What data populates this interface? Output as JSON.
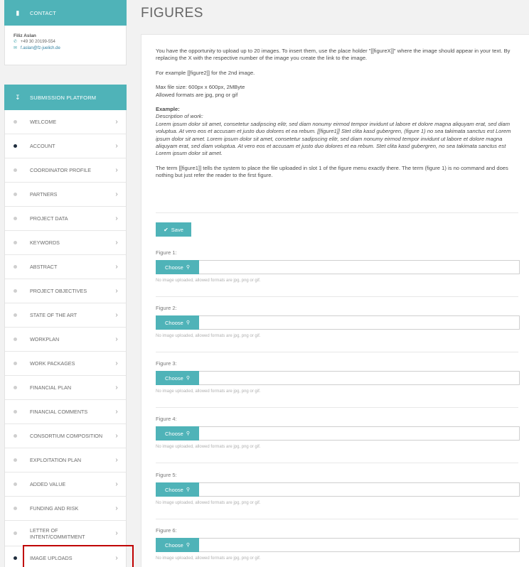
{
  "contact": {
    "header": "CONTACT",
    "name": "Filiz Aslan",
    "phone": "+49 30 20199-554",
    "email": "f.aslan@fz-juelich.de"
  },
  "submission": {
    "header": "SUBMISSION PLATFORM",
    "items": [
      {
        "label": "WELCOME",
        "status": "empty"
      },
      {
        "label": "ACCOUNT",
        "status": "done"
      },
      {
        "label": "COORDINATOR PROFILE",
        "status": "empty"
      },
      {
        "label": "PARTNERS",
        "status": "empty"
      },
      {
        "label": "PROJECT DATA",
        "status": "empty"
      },
      {
        "label": "KEYWORDS",
        "status": "empty"
      },
      {
        "label": "ABSTRACT",
        "status": "empty"
      },
      {
        "label": "PROJECT OBJECTIVES",
        "status": "empty"
      },
      {
        "label": "STATE OF THE ART",
        "status": "empty"
      },
      {
        "label": "WORKPLAN",
        "status": "empty"
      },
      {
        "label": "WORK PACKAGES",
        "status": "empty"
      },
      {
        "label": "FINANCIAL PLAN",
        "status": "empty"
      },
      {
        "label": "FINANCIAL COMMENTS",
        "status": "empty"
      },
      {
        "label": "CONSORTIUM COMPOSITION",
        "status": "empty"
      },
      {
        "label": "EXPLOITATION PLAN",
        "status": "empty"
      },
      {
        "label": "ADDED VALUE",
        "status": "empty"
      },
      {
        "label": "FUNDING AND RISK",
        "status": "empty"
      },
      {
        "label": "LETTER OF INTENT/COMMITMENT",
        "status": "empty"
      },
      {
        "label": "IMAGE UPLOADS",
        "status": "done"
      }
    ]
  },
  "page": {
    "title": "FIGURES",
    "intro": "You have the opportunity to upload up to 20 images. To insert them, use the place holder \"[[figureX]]\" where the image should appear in your text. By replacing the X with the respective number of the image you create the link to the image.",
    "example_line": "For example [[figure2]] for the 2nd image.",
    "max_size": "Max file size: 600px x 600px, 2MByte",
    "formats": "Allowed formats are jpg, png or gif",
    "example_head": "Example:",
    "example_sub": "Description of work:",
    "example_text": "Lorem ipsum dolor sit amet, consetetur sadipscing elitr, sed diam nonumy eirmod tempor invidunt ut labore et dolore magna aliquyam erat, sed diam voluptua. At vero eos et accusam et justo duo dolores et ea rebum. [[figure1]] Stet clita kasd gubergren, (figure 1) no sea takimata sanctus est Lorem ipsum dolor sit amet. Lorem ipsum dolor sit amet, consetetur sadipscing elitr, sed diam nonumy eirmod tempor invidunt ut labore et dolore magna aliquyam erat, sed diam voluptua. At vero eos et accusam et justo duo dolores et ea rebum. Stet clita kasd gubergren, no sea takimata sanctus est Lorem ipsum dolor sit amet.",
    "term_text": "The term [[figure1]] tells the system to place the file uploaded in slot 1 of the figure menu exactly there. The term (figure 1) is no command and does nothing but just refer the reader to the first figure.",
    "save_label": "Save",
    "choose_label": "Choose",
    "hint": "No image uploaded, allowed formats are jpg, png or gif.",
    "figures": [
      "Figure 1:",
      "Figure 2:",
      "Figure 3:",
      "Figure 4:",
      "Figure 5:",
      "Figure 6:"
    ]
  },
  "colors": {
    "accent": "#4fb3b8",
    "highlight": "#c00000"
  }
}
